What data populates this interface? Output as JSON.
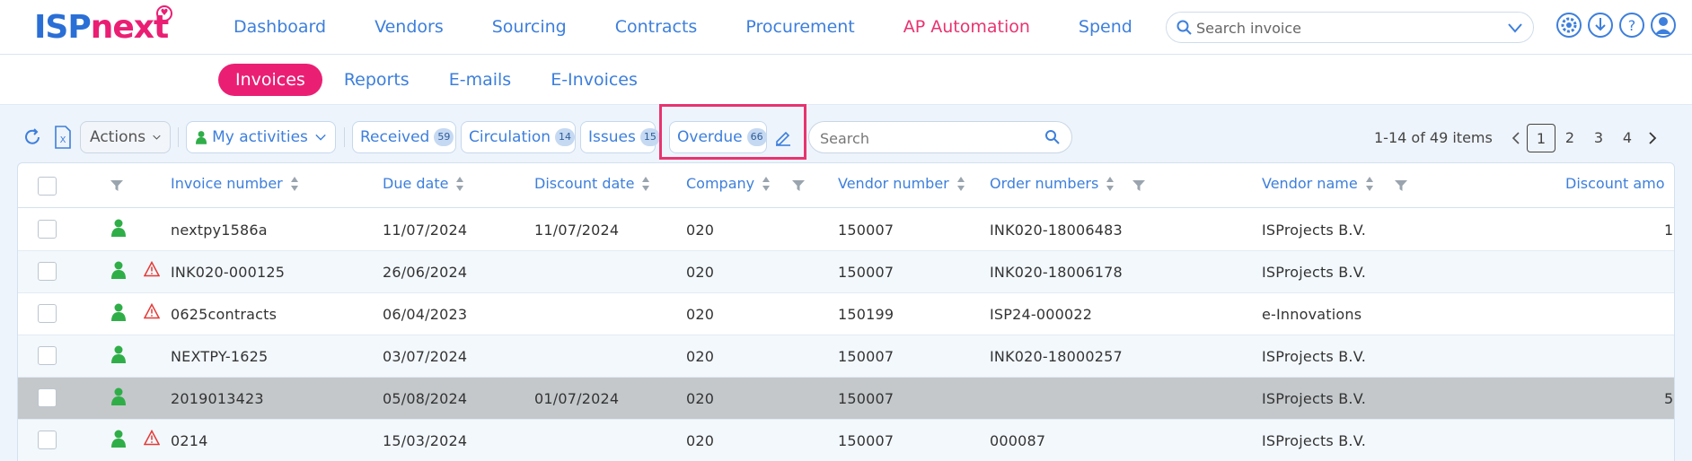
{
  "app": {
    "logo_part1": "ISP",
    "logo_part2": "next",
    "brand_colors": {
      "blue": "#2a6fd6",
      "pink": "#ea1f74"
    }
  },
  "main_nav": [
    {
      "label": "Dashboard",
      "active": false
    },
    {
      "label": "Vendors",
      "active": false
    },
    {
      "label": "Sourcing",
      "active": false
    },
    {
      "label": "Contracts",
      "active": false
    },
    {
      "label": "Procurement",
      "active": false
    },
    {
      "label": "AP Automation",
      "active": true
    },
    {
      "label": "Spend",
      "active": false
    }
  ],
  "top_search": {
    "placeholder": "Search invoice",
    "value": ""
  },
  "top_icons": [
    "gear-icon",
    "download-icon",
    "help-icon",
    "user-icon"
  ],
  "sub_nav": [
    {
      "label": "Invoices",
      "active": true
    },
    {
      "label": "Reports",
      "active": false
    },
    {
      "label": "E-mails",
      "active": false
    },
    {
      "label": "E-Invoices",
      "active": false
    }
  ],
  "toolbar": {
    "actions_label": "Actions",
    "my_activities_label": "My activities",
    "filters": [
      {
        "label": "Received",
        "count": "59"
      },
      {
        "label": "Circulation",
        "count": "14"
      },
      {
        "label": "Issues",
        "count": "15"
      },
      {
        "label": "Overdue",
        "count": "66"
      }
    ],
    "search_placeholder": "Search",
    "search_value": ""
  },
  "pager": {
    "summary": "1-14 of 49 items",
    "pages": [
      "1",
      "2",
      "3",
      "4"
    ],
    "current": "1"
  },
  "columns": {
    "invoice_number": "Invoice number",
    "due_date": "Due date",
    "discount_date": "Discount date",
    "company": "Company",
    "vendor_number": "Vendor number",
    "order_numbers": "Order numbers",
    "vendor_name": "Vendor name",
    "discount_amount": "Discount amo"
  },
  "rows": [
    {
      "invoice_number": "nextpy1586a",
      "due_date": "11/07/2024",
      "discount_date": "11/07/2024",
      "company": "020",
      "vendor_number": "150007",
      "order_numbers": "INK020-18006483",
      "vendor_name": "ISProjects B.V.",
      "discount_amount": "1",
      "warning": false,
      "selected": false
    },
    {
      "invoice_number": "INK020-000125",
      "due_date": "26/06/2024",
      "discount_date": "",
      "company": "020",
      "vendor_number": "150007",
      "order_numbers": "INK020-18006178",
      "vendor_name": "ISProjects B.V.",
      "discount_amount": "",
      "warning": true,
      "selected": false
    },
    {
      "invoice_number": "0625contracts",
      "due_date": "06/04/2023",
      "discount_date": "",
      "company": "020",
      "vendor_number": "150199",
      "order_numbers": "ISP24-000022",
      "vendor_name": "e-Innovations",
      "discount_amount": "",
      "warning": true,
      "selected": false
    },
    {
      "invoice_number": "NEXTPY-1625",
      "due_date": "03/07/2024",
      "discount_date": "",
      "company": "020",
      "vendor_number": "150007",
      "order_numbers": "INK020-18000257",
      "vendor_name": "ISProjects B.V.",
      "discount_amount": "",
      "warning": false,
      "selected": false
    },
    {
      "invoice_number": "2019013423",
      "due_date": "05/08/2024",
      "discount_date": "01/07/2024",
      "company": "020",
      "vendor_number": "150007",
      "order_numbers": "",
      "vendor_name": "ISProjects B.V.",
      "discount_amount": "5",
      "warning": false,
      "selected": true
    },
    {
      "invoice_number": "0214",
      "due_date": "15/03/2024",
      "discount_date": "",
      "company": "020",
      "vendor_number": "150007",
      "order_numbers": "000087",
      "vendor_name": "ISProjects B.V.",
      "discount_amount": "",
      "warning": true,
      "selected": false
    }
  ],
  "colors": {
    "link": "#3d7fdc",
    "active_nav": "#e8336f",
    "status_person": "#2fae48",
    "warning": "#e53935",
    "highlight_box": "#e8336f"
  }
}
